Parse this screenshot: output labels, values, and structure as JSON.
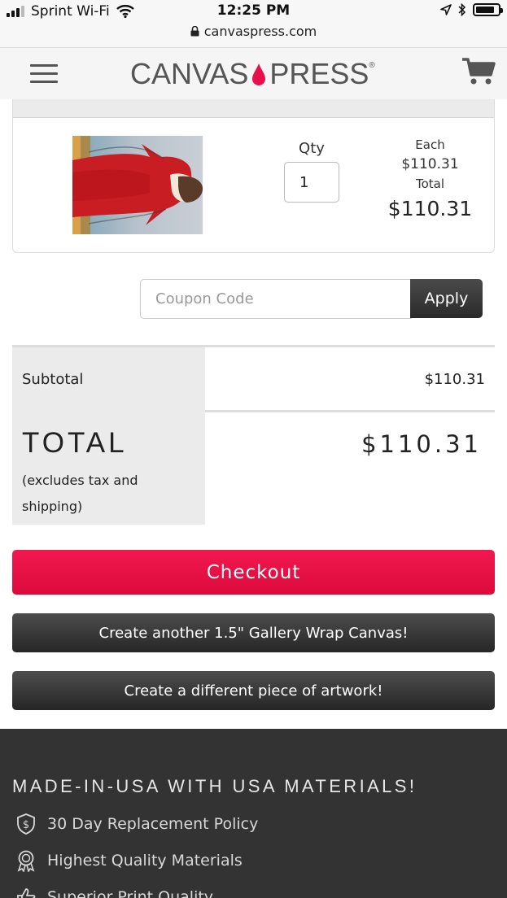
{
  "status_bar": {
    "carrier": "Sprint Wi-Fi",
    "time": "12:25 PM",
    "url": "canvaspress.com",
    "battery_level": 0.85
  },
  "header": {
    "logo_left": "CANVAS",
    "logo_right": "PRESS",
    "logo_mark": "®",
    "menu_icon": "hamburger-icon",
    "cart_icon": "shopping-cart-icon"
  },
  "cart_item": {
    "qty_label": "Qty",
    "qty_value": "1",
    "each_label": "Each",
    "each_price": "$110.31",
    "total_label": "Total",
    "total_price": "$110.31"
  },
  "coupon": {
    "placeholder": "Coupon Code",
    "apply_label": "Apply"
  },
  "totals": {
    "subtotal_label": "Subtotal",
    "subtotal_value": "$110.31",
    "total_label": "TOTAL",
    "total_note": "(excludes tax and shipping)",
    "total_value": "$110.31"
  },
  "actions": {
    "checkout_label": "Checkout",
    "create_another_label": "Create another 1.5\" Gallery Wrap Canvas!",
    "create_different_label": "Create a different piece of artwork!"
  },
  "footer": {
    "heading": "MADE-IN-USA WITH USA MATERIALS!",
    "items": [
      {
        "label": "30 Day Replacement Policy",
        "icon": "shield-dollar-icon"
      },
      {
        "label": "Highest Quality Materials",
        "icon": "award-ribbon-icon"
      },
      {
        "label": "Superior Print Quality",
        "icon": "thumbs-up-icon"
      }
    ]
  },
  "colors": {
    "accent": "#e8104a",
    "dark_button": "#333333",
    "footer_bg": "#333333"
  }
}
